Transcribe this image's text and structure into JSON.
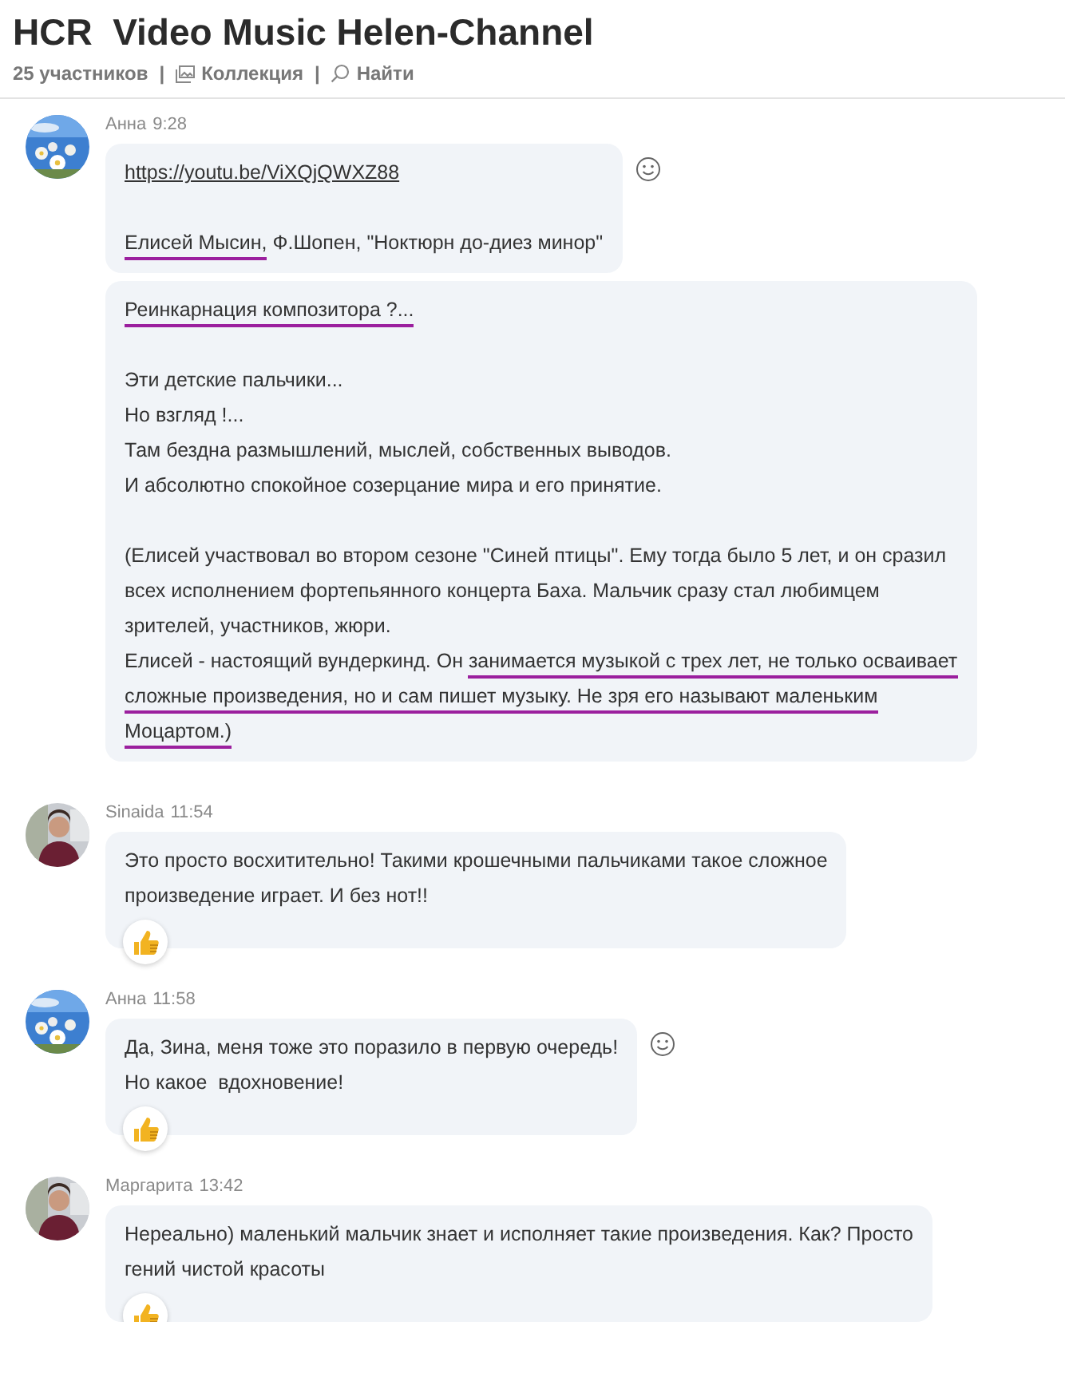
{
  "header": {
    "title": "HCR  Video Music Helen-Channel",
    "meta": [
      {
        "kind": "count",
        "text": "25 участников"
      },
      {
        "kind": "separator",
        "text": "|"
      },
      {
        "kind": "collection",
        "text": "Коллекция"
      },
      {
        "kind": "separator",
        "text": "|"
      },
      {
        "kind": "search",
        "text": "Найти"
      }
    ]
  },
  "messages": [
    {
      "author": "Анна",
      "time": "9:28",
      "emoji_button": true,
      "liked": false,
      "bubbles": [
        {
          "lines": [
            {
              "kind": "link",
              "segments": [
                {
                  "text": "https://youtu.be/ViXQjQWXZ88",
                  "marked": false
                }
              ]
            },
            {
              "kind": "blank"
            },
            {
              "kind": "text",
              "segments": [
                {
                  "text": "Елисей Мысин,",
                  "marked": true
                },
                {
                  "text": " Ф.Шопен, \"Ноктюрн до-диез минор\"",
                  "marked": false
                }
              ]
            }
          ]
        },
        {
          "lines": [
            {
              "kind": "text",
              "segments": [
                {
                  "text": "Реинкарнация композитора ?...",
                  "marked": true
                }
              ]
            },
            {
              "kind": "blank"
            },
            {
              "kind": "text",
              "segments": [
                {
                  "text": "Эти детские пальчики...",
                  "marked": false
                }
              ]
            },
            {
              "kind": "text",
              "segments": [
                {
                  "text": "Но взгляд !...",
                  "marked": false
                }
              ]
            },
            {
              "kind": "text",
              "segments": [
                {
                  "text": "Там бездна размышлений, мыслей, собственных выводов.",
                  "marked": false
                }
              ]
            },
            {
              "kind": "text",
              "segments": [
                {
                  "text": "И абсолютно спокойное созерцание мира и его принятие.",
                  "marked": false
                }
              ]
            },
            {
              "kind": "blank"
            },
            {
              "kind": "text",
              "segments": [
                {
                  "text": "(Елисей участвовал во втором сезоне \"Синей птицы\". Ему тогда было 5 лет, и он сразил",
                  "marked": false
                }
              ]
            },
            {
              "kind": "text",
              "segments": [
                {
                  "text": "всех исполнением фортепьянного концерта Баха. Мальчик сразу стал любимцем",
                  "marked": false
                }
              ]
            },
            {
              "kind": "text",
              "segments": [
                {
                  "text": "зрителей, участников, жюри.",
                  "marked": false
                }
              ]
            },
            {
              "kind": "text",
              "segments": [
                {
                  "text": "Елисей - настоящий вундеркинд. Он ",
                  "marked": false
                },
                {
                  "text": "занимается музыкой с трех лет, не только осваивает",
                  "marked": true
                }
              ]
            },
            {
              "kind": "text",
              "segments": [
                {
                  "text": "сложные произведения, но и сам пишет музыку. Не зря его называют маленьким",
                  "marked": true
                }
              ]
            },
            {
              "kind": "text",
              "segments": [
                {
                  "text": "Моцартом.)",
                  "marked": true
                }
              ]
            }
          ]
        }
      ]
    },
    {
      "author": "Sinaida",
      "time": "11:54",
      "emoji_button": false,
      "liked": true,
      "bubbles": [
        {
          "lines": [
            {
              "kind": "text",
              "segments": [
                {
                  "text": "Это просто восхитительно! Такими крошечными пальчиками такое сложное",
                  "marked": false
                }
              ]
            },
            {
              "kind": "text",
              "segments": [
                {
                  "text": "произведение играет. И без нот!!",
                  "marked": false
                }
              ]
            }
          ]
        }
      ]
    },
    {
      "author": "Анна",
      "time": "11:58",
      "emoji_button": true,
      "liked": true,
      "bubbles": [
        {
          "lines": [
            {
              "kind": "text",
              "segments": [
                {
                  "text": "Да, Зина, меня тоже это поразило в первую очередь!",
                  "marked": false
                }
              ]
            },
            {
              "kind": "text",
              "segments": [
                {
                  "text": "Но какое  вдохновение!",
                  "marked": false
                }
              ]
            }
          ]
        }
      ]
    },
    {
      "author": "Маргарита",
      "time": "13:42",
      "emoji_button": false,
      "liked": true,
      "bubbles": [
        {
          "lines": [
            {
              "kind": "text",
              "segments": [
                {
                  "text": "Нереально) маленький мальчик знает и исполняет такие произведения. Как? Просто",
                  "marked": false
                }
              ]
            },
            {
              "kind": "text",
              "segments": [
                {
                  "text": "гений чистой красоты",
                  "marked": false
                }
              ]
            }
          ]
        }
      ]
    }
  ]
}
